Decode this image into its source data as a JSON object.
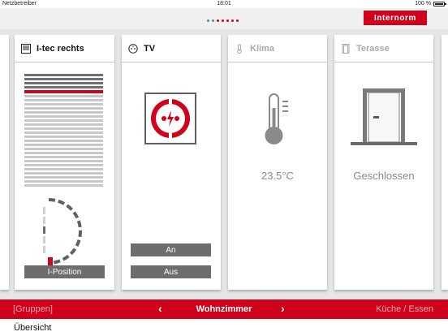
{
  "status_bar": {
    "carrier": "Netzbetreiber",
    "time": "18:01",
    "battery": "100 %"
  },
  "header": {
    "brand": "Internorm",
    "page_indicator": {
      "count": 7,
      "active": 3
    }
  },
  "cards": {
    "itec": {
      "title": "I-tec rechts",
      "icon": "blind-icon",
      "button_label": "I-Position"
    },
    "tv": {
      "title": "TV",
      "icon": "socket-icon",
      "on_label": "An",
      "off_label": "Aus"
    },
    "klima": {
      "title": "Klima",
      "icon": "thermometer-icon",
      "value": "23.5°C"
    },
    "terasse": {
      "title": "Terasse",
      "icon": "door-icon",
      "value": "Geschlossen"
    }
  },
  "bottom_nav": {
    "groups_label": "[Gruppen]",
    "prev_icon": "chevron-left-icon",
    "room": "Wohnzimmer",
    "next_icon": "chevron-right-icon",
    "next_room": "Küche / Essen"
  },
  "footer": {
    "overview": "Übersicht"
  },
  "colors": {
    "accent": "#d0021b",
    "button_grey": "#6d6d6d",
    "background": "#e6e6e6"
  }
}
